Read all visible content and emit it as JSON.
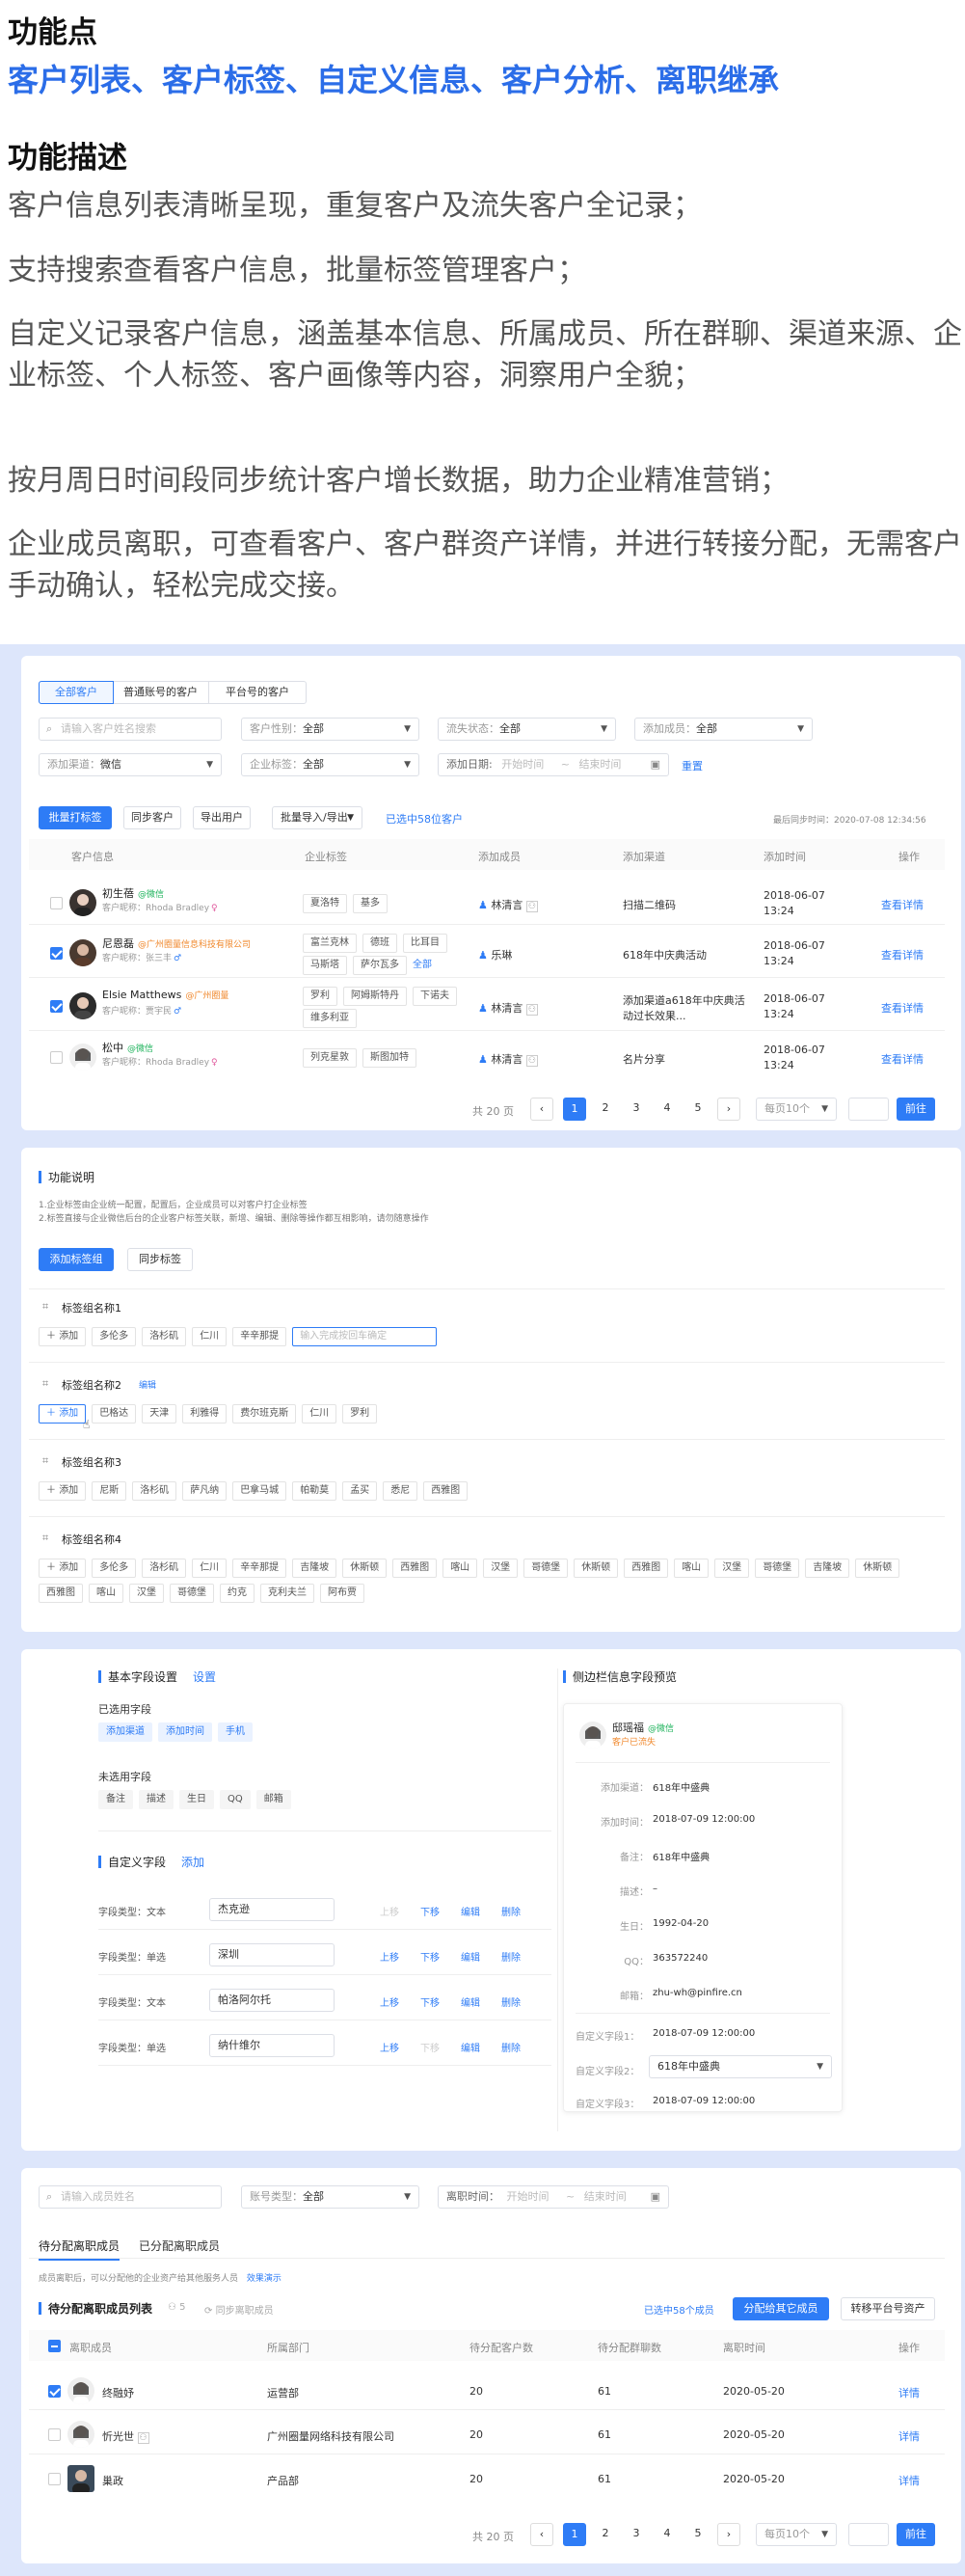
{
  "intro": {
    "title1": "功能点",
    "features": "客户列表、客户标签、自定义信息、客户分析、离职继承",
    "title2": "功能描述",
    "paras": [
      "客户信息列表清晰呈现，重复客户及流失客户全记录；",
      "支持搜索查看客户信息，批量标签管理客户；",
      "自定义记录客户信息，涵盖基本信息、所属成员、所在群聊、渠道来源、企业标签、个人标签、客户画像等内容，洞察用户全貌；",
      "按月周日时间段同步统计客户增长数据，助力企业精准营销；",
      "企业成员离职，可查看客户、客户群资产详情，并进行转接分配，无需客户手动确认，轻松完成交接。"
    ]
  },
  "customers": {
    "tabs": [
      "全部客户",
      "普通账号的客户",
      "平台号的客户"
    ],
    "search_placeholder": "请输入客户姓名搜索",
    "filters": [
      {
        "label": "客户性别：",
        "value": "全部"
      },
      {
        "label": "流失状态：",
        "value": "全部"
      },
      {
        "label": "添加成员：",
        "value": "全部"
      },
      {
        "label": "添加渠道：",
        "value": "微信"
      },
      {
        "label": "企业标签：",
        "value": "全部"
      }
    ],
    "date_label": "添加日期:",
    "date_start": "开始时间",
    "date_sep": "~",
    "date_end": "结束时间",
    "reset": "重置",
    "actions": [
      "批量打标签",
      "同步客户",
      "导出用户",
      "批量导入/导出"
    ],
    "selected": "已选中58位客户",
    "sync_time": "最后同步时间：2020-07-08 12:34:56",
    "columns": [
      "客户信息",
      "企业标签",
      "添加成员",
      "添加渠道",
      "添加时间",
      "操作"
    ],
    "rows": [
      {
        "name": "初生蓓",
        "badge": "@微信",
        "nick": "客户昵称：Rhoda Bradley",
        "tags": [
          "夏洛特",
          "基多"
        ],
        "member": "林清言",
        "channel": "扫描二维码",
        "date": "2018-06-07",
        "time": "13:24",
        "op": "查看详情",
        "checked": false
      },
      {
        "name": "尼恩磊",
        "badge": "@广州圈量信息科技有限公司",
        "nick": "客户昵称：张三丰",
        "tags": [
          "富兰克林",
          "德班",
          "比耳目",
          "马斯塔",
          "萨尔瓦多"
        ],
        "tag_more": "全部",
        "member": "乐琳",
        "channel": "618年中庆典活动",
        "date": "2018-06-07",
        "time": "13:24",
        "op": "查看详情",
        "checked": true
      },
      {
        "name": "Elsie Matthews",
        "badge": "@广州圈量",
        "nick": "客户昵称：贾宇民",
        "tags": [
          "罗利",
          "阿姆斯特丹",
          "下诺夫",
          "维多利亚"
        ],
        "member": "林清言",
        "channel": "添加渠道a618年中庆典活",
        "channel2": "动过长效果...",
        "date": "2018-06-07",
        "time": "13:24",
        "op": "查看详情",
        "checked": true
      },
      {
        "name": "松中",
        "badge": "@微信",
        "nick": "客户昵称：Rhoda Bradley",
        "tags": [
          "列克星敦",
          "斯图加特"
        ],
        "member": "林清言",
        "channel": "名片分享",
        "date": "2018-06-07",
        "time": "13:24",
        "op": "查看详情",
        "checked": false
      }
    ],
    "pagination": {
      "total": "共 20 页",
      "pages": [
        "1",
        "2",
        "3",
        "4",
        "5"
      ],
      "current": "1",
      "size": "每页10个",
      "go": "前往"
    }
  },
  "tags_panel": {
    "title": "功能说明",
    "desc1": "1.企业标签由企业统一配置，配置后，企业成员可以对客户打企业标签",
    "desc2": "2.标签直接与企业微信后台的企业客户标签关联，新增、编辑、删除等操作都互相影响，请勿随意操作",
    "add_group": "添加标签组",
    "sync": "同步标签",
    "add": "添加",
    "edit": "编辑",
    "input_placeholder": "输入完成按回车确定",
    "groups": [
      {
        "name": "标签组名称1",
        "tags": [
          "多伦多",
          "洛杉矶",
          "仁川",
          "辛辛那提"
        ]
      },
      {
        "name": "标签组名称2",
        "tags": [
          "巴格达",
          "天津",
          "利雅得",
          "费尔班克斯",
          "仁川",
          "罗利"
        ]
      },
      {
        "name": "标签组名称3",
        "tags": [
          "尼斯",
          "洛杉矶",
          "萨凡纳",
          "巴拿马城",
          "帕勒莫",
          "孟买",
          "悉尼",
          "西雅图"
        ]
      },
      {
        "name": "标签组名称4",
        "tags": [
          "多伦多",
          "洛杉矶",
          "仁川",
          "辛辛那提",
          "吉隆坡",
          "休斯顿",
          "西雅图",
          "喀山",
          "汉堡",
          "哥德堡",
          "休斯顿",
          "西雅图",
          "喀山",
          "汉堡",
          "哥德堡",
          "吉隆坡",
          "休斯顿",
          "西雅图",
          "喀山",
          "汉堡",
          "哥德堡",
          "约克",
          "克利夫兰",
          "阿布贾"
        ]
      }
    ]
  },
  "fields_panel": {
    "basic_title": "基本字段设置",
    "settings": "设置",
    "selected_label": "已选用字段",
    "selected_fields": [
      "添加渠道",
      "添加时间",
      "手机"
    ],
    "unselected_label": "未选用字段",
    "unselected_fields": [
      "备注",
      "描述",
      "生日",
      "QQ",
      "邮箱"
    ],
    "custom_title": "自定义字段",
    "custom_add": "添加",
    "custom_rows": [
      {
        "type": "字段类型：文本",
        "value": "杰克逊",
        "up": "上移",
        "down": "下移",
        "edit": "编辑",
        "del": "删除",
        "up_disabled": true,
        "down_disabled": false
      },
      {
        "type": "字段类型：单选",
        "value": "深圳",
        "up": "上移",
        "down": "下移",
        "edit": "编辑",
        "del": "删除",
        "up_disabled": false,
        "down_disabled": false
      },
      {
        "type": "字段类型：文本",
        "value": "帕洛阿尔托",
        "up": "上移",
        "down": "下移",
        "edit": "编辑",
        "del": "删除",
        "up_disabled": false,
        "down_disabled": false
      },
      {
        "type": "字段类型：单选",
        "value": "纳什维尔",
        "up": "上移",
        "down": "下移",
        "edit": "编辑",
        "del": "删除",
        "up_disabled": false,
        "down_disabled": true
      }
    ],
    "preview_title": "侧边栏信息字段预览",
    "preview_name": "邸瑶福",
    "preview_badge": "@微信",
    "preview_status": "客户已流失",
    "preview_rows": [
      {
        "label": "添加渠道：",
        "value": "618年中盛典"
      },
      {
        "label": "添加时间：",
        "value": "2018-07-09 12:00:00"
      },
      {
        "label": "备注：",
        "value": "618年中盛典"
      },
      {
        "label": "描述：",
        "value": "–"
      },
      {
        "label": "生日：",
        "value": "1992-04-20"
      },
      {
        "label": "QQ：",
        "value": "363572240"
      },
      {
        "label": "邮箱：",
        "value": "zhu-wh@pinfire.cn"
      }
    ],
    "custom_preview": [
      {
        "label": "自定义字段1：",
        "value": "2018-07-09 12:00:00"
      },
      {
        "label": "自定义字段2：",
        "value": "618年中盛典"
      },
      {
        "label": "自定义字段3：",
        "value": "2018-07-09 12:00:00"
      }
    ]
  },
  "resign": {
    "search_placeholder": "请输入成员姓名",
    "account_label": "账号类型：",
    "account_value": "全部",
    "time_label": "离职时间：",
    "time_start": "开始时间",
    "time_sep": "~",
    "time_end": "结束时间",
    "tabs": [
      "待分配离职成员",
      "已分配离职成员"
    ],
    "tip": "成员离职后，可以分配他的企业资产给其他服务人员",
    "tip_link": "效果演示",
    "list_title": "待分配离职成员列表",
    "count": "5",
    "sync": "同步离职成员",
    "selected": "已选中58个成员",
    "assign": "分配给其它成员",
    "transfer": "转移平台号资产",
    "columns": [
      "离职成员",
      "所属部门",
      "待分配客户数",
      "待分配群聊数",
      "离职时间",
      "操作"
    ],
    "rows": [
      {
        "name": "终融妤",
        "dept": "运营部",
        "customers": "20",
        "groups": "61",
        "date": "2020-05-20",
        "op": "详情",
        "checked": true
      },
      {
        "name": "忻光世",
        "dept": "广州圈量网络科技有限公司",
        "customers": "20",
        "groups": "61",
        "date": "2020-05-20",
        "op": "详情",
        "checked": false
      },
      {
        "name": "巢政",
        "dept": "产品部",
        "customers": "20",
        "groups": "61",
        "date": "2020-05-20",
        "op": "详情",
        "checked": false
      }
    ],
    "pagination": {
      "total": "共 20 页",
      "pages": [
        "1",
        "2",
        "3",
        "4",
        "5"
      ],
      "size": "每页10个",
      "go": "前往"
    }
  }
}
